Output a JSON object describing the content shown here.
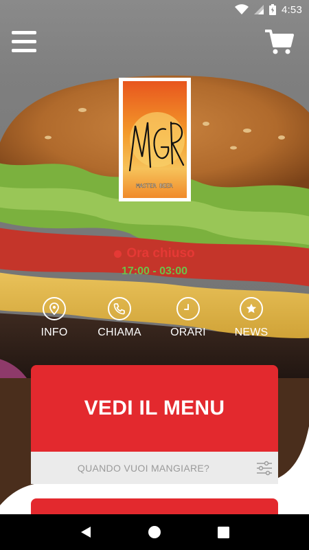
{
  "status_bar": {
    "time": "4:53"
  },
  "brand": {
    "logo_line1": "MGR",
    "logo_line2": "MASTER BEER"
  },
  "shop_status": {
    "label": "Ora chiuso",
    "hours": "17:00 - 03:00",
    "color": "#e53935",
    "hours_color": "#6cc24a"
  },
  "actions": [
    {
      "label": "INFO",
      "icon": "location-pin-icon"
    },
    {
      "label": "CHIAMA",
      "icon": "phone-icon"
    },
    {
      "label": "ORARI",
      "icon": "clock-icon"
    },
    {
      "label": "NEWS",
      "icon": "star-chat-icon"
    }
  ],
  "menu_card": {
    "label": "VEDI IL MENU",
    "color": "#e3292e"
  },
  "when_bar": {
    "placeholder": "QUANDO VUOI MANGIARE?"
  }
}
